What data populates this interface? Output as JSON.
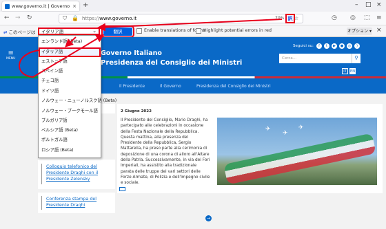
{
  "browser": {
    "tab_title": "www.governo.it | Governo Italia",
    "tab_close": "×",
    "new_tab": "+",
    "url_dim": "https://",
    "url_main": "www.governo.it",
    "zoom": "70%",
    "translate_icon_text": "訳"
  },
  "translation_bar": {
    "label": "このページは",
    "language_selected": "イタリア語",
    "translate_button": "翻訳",
    "enable_forms": "Enable translations of forms",
    "highlight_errors": "Highlight potential errors in red",
    "options": "オプション ▾",
    "close": "×"
  },
  "language_dropdown": [
    "エンランド語 (Beta)",
    "イタリア語",
    "エストニア語",
    "スペイン語",
    "チェコ語",
    "ドイツ語",
    "ノルウェー・ニューノルスク語 (Beta)",
    "ノルウェー・ブークモール語",
    "ブルガリア語",
    "ペルシア語 (Beta)",
    "ポルトガル語",
    "ロシア語 (Beta)"
  ],
  "site": {
    "menu_label": "MENU",
    "title_line1": "Governo Italiano",
    "title_line2": "Presidenza del Consiglio dei Ministri",
    "follow_us": "Seguici su:",
    "search_placeholder": "Cerca...",
    "lang_it": "IT",
    "lang_en": "EN",
    "nav": [
      "Il Presidente",
      "Il Governo",
      "Presidenza del Consiglio dei Ministri"
    ]
  },
  "article": {
    "date": "2 Giugno 2022",
    "text": "Il Presidente del Consiglio, Mario Draghi, ha partecipato alle celebrazioni in occasione della Festa Nazionale della Repubblica. Questa mattina, alla presenza del Presidente della Repubblica, Sergio Mattarella, ha preso parte alla cerimonia di deposizione di una corona di alloro all'Altare della Patria. Successivamente, in via dei Fori Imperiali, ha assistito alla tradizionale parata delle truppe dei vari settori delle Forze Armate, di Polizia e dell'impegno civile e sociale."
  },
  "side_links": [
    "Colloquio telefonico del Presidente Draghi con il Presidente Zelensky",
    "Conferenza stampa del Presidente Draghi"
  ],
  "colors": {
    "header_blue": "#0a69c7",
    "annotation_red": "#e8001c",
    "firefox_blue": "#0060df"
  }
}
